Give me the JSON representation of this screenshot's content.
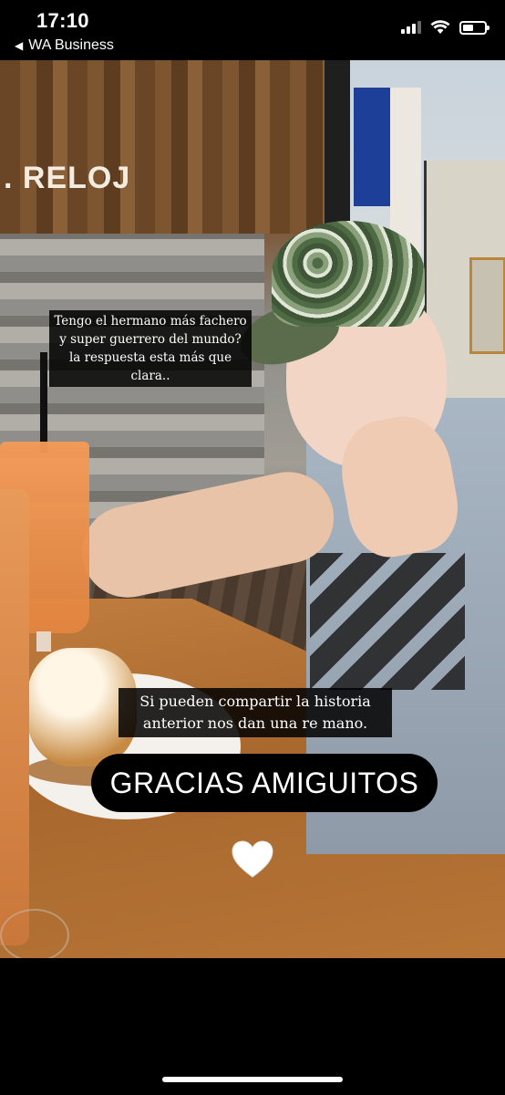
{
  "status_bar": {
    "time": "17:10",
    "back_label": "WA Business",
    "battery_level": 0.5
  },
  "story": {
    "sign_text": ". RELOJ",
    "caption_top": "Tengo el hermano más fachero y super guerrero del mundo? la respuesta esta más que clara..",
    "caption_middle": "Si pueden compartir la historia anterior nos dan una re mano.",
    "pill_text": "GRACIAS AMIGUITOS",
    "heart_color": "#ffffff"
  }
}
